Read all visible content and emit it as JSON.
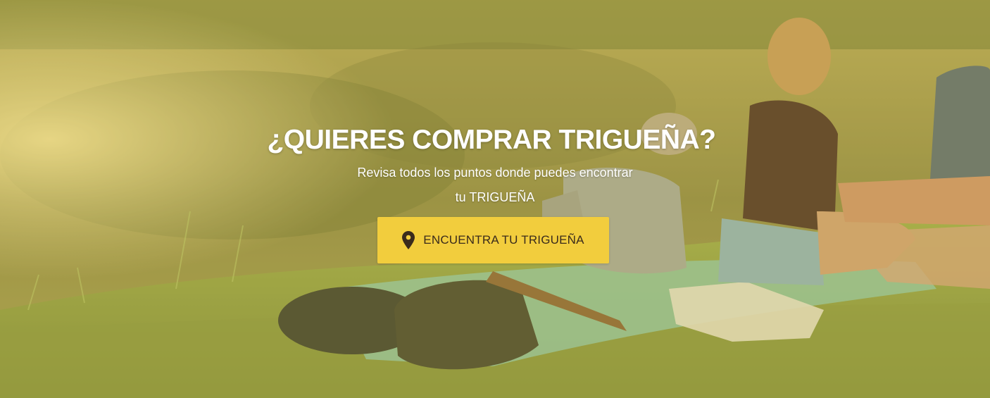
{
  "hero": {
    "title": "¿QUIERES COMPRAR TRIGUEÑA?",
    "subtitle_line1": "Revisa todos los puntos donde puedes encontrar",
    "subtitle_line2": "tu TRIGUEÑA",
    "cta_label": "ENCUENTRA TU TRIGUEÑA",
    "cta_icon": "map-pin-icon",
    "background_image": "picnic-by-lake-photo"
  },
  "colors": {
    "cta_background": "#f2cd3d",
    "cta_text": "#3a2b1c",
    "headline_text": "#ffffff",
    "overlay_tint": "#cdb446"
  }
}
